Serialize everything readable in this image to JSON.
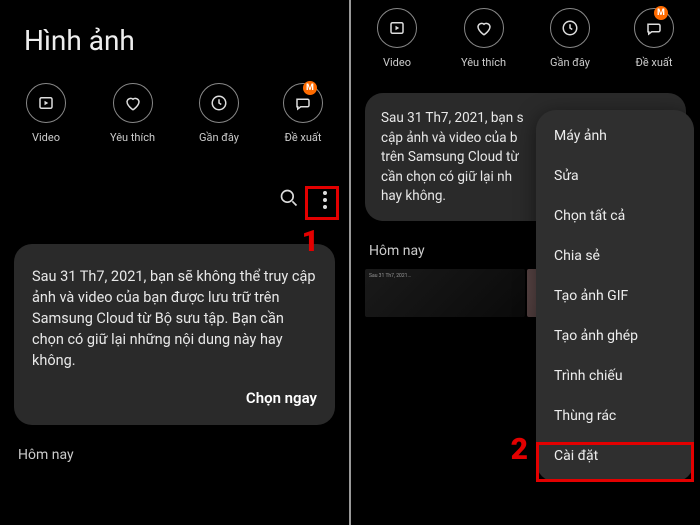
{
  "title": "Hình ảnh",
  "quick": {
    "video": "Video",
    "favorite": "Yêu thích",
    "recent": "Gần đây",
    "suggest": "Đề xuất",
    "badge": "M"
  },
  "card_text": "Sau 31 Th7, 2021, bạn sẽ không thể truy cập ảnh và video của bạn được lưu trữ trên Samsung Cloud từ Bộ sưu tập. Bạn cần chọn có giữ lại những nội dung này hay không.",
  "card_text_partial": "Sau 31 Th7, 2021, bạn s\ncập ảnh và video của b\ntrên Samsung Cloud từ\ncần chọn có giữ lại nh\nhay không.",
  "card_action": "Chọn ngay",
  "today": "Hôm nay",
  "menu": {
    "camera": "Máy ảnh",
    "edit": "Sửa",
    "select_all": "Chọn tất cả",
    "share": "Chia sẻ",
    "gif": "Tạo ảnh GIF",
    "collage": "Tạo ảnh ghép",
    "slideshow": "Trình chiếu",
    "trash": "Thùng rác",
    "settings": "Cài đặt"
  },
  "step1": "1",
  "step2": "2"
}
